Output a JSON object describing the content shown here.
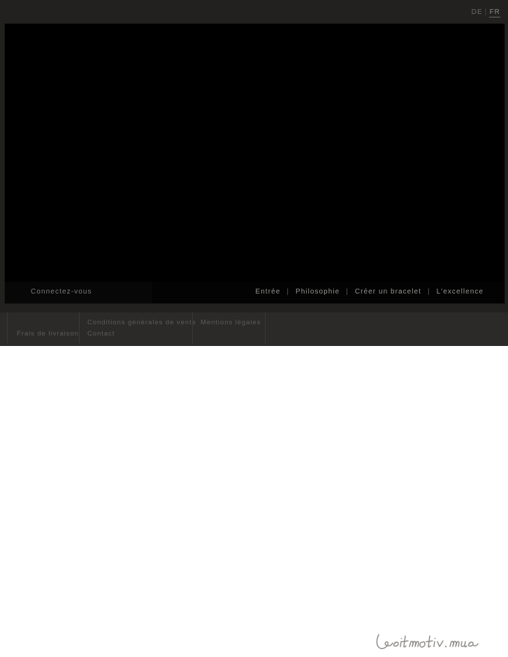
{
  "site": {
    "brand": "leitmotiv.me",
    "background_color": "#222120",
    "stage_color": "#000000",
    "footer_color": "#2b2a29",
    "accent_text_color": "#9a9894"
  },
  "topbar": {
    "languages": [
      {
        "code": "DE",
        "label": "DE",
        "active": false
      },
      {
        "code": "FR",
        "label": "FR",
        "active": true
      }
    ],
    "separator": "|"
  },
  "stage": {
    "login_label": "Connectez-vous",
    "nav": {
      "separator": "|",
      "items": [
        {
          "label": "Entrée"
        },
        {
          "label": "Philosophie"
        },
        {
          "label": "Créer un bracelet"
        },
        {
          "label": "L'excellence"
        }
      ]
    }
  },
  "footer": {
    "columns": [
      {
        "links": [
          {
            "label": "Frais de livraison"
          }
        ]
      },
      {
        "links": [
          {
            "label": "Conditions générales de vente"
          },
          {
            "label": "Contact"
          }
        ]
      },
      {
        "links": [
          {
            "label": "Mentions légales"
          }
        ]
      }
    ],
    "brand_label": "leitmotiv.me"
  }
}
